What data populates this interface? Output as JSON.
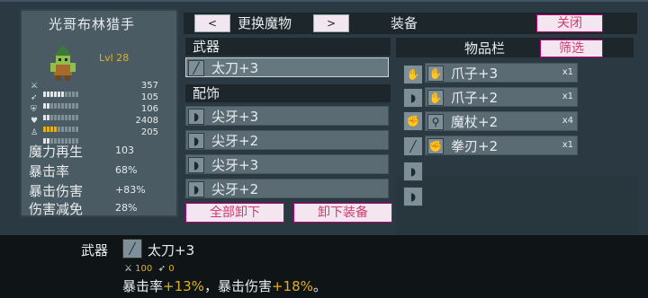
{
  "character": {
    "name": "光哥布林猎手",
    "level": "Lvl 28",
    "stats": [
      {
        "icon": "sword-icon",
        "glyph": "⚔",
        "value": "357"
      },
      {
        "icon": "bow-icon",
        "glyph": "➶",
        "value": "105"
      },
      {
        "icon": "shield-icon",
        "glyph": "⛨",
        "value": "106"
      },
      {
        "icon": "heart-icon",
        "glyph": "♥",
        "value": "2408"
      },
      {
        "icon": "boot-icon",
        "glyph": "♙",
        "value": "205"
      }
    ],
    "attributes": [
      {
        "name": "魔力再生",
        "value": "103"
      },
      {
        "name": "暴击率",
        "value": "68%"
      },
      {
        "name": "暴击伤害",
        "value": "+83%"
      },
      {
        "name": "伤害减免",
        "value": "28%"
      }
    ]
  },
  "topbar": {
    "prev": "<",
    "title": "更换魔物",
    "next": ">",
    "equip_title": "装备",
    "close": "关闭"
  },
  "weapon_section": {
    "title": "武器",
    "item": "太刀+3"
  },
  "accessory_section": {
    "title": "配饰",
    "items": [
      "尖牙+3",
      "尖牙+2",
      "尖牙+3",
      "尖牙+2"
    ]
  },
  "actions": {
    "unequip_all": "全部卸下",
    "unequip": "卸下装备"
  },
  "inventory": {
    "title": "物品栏",
    "filter": "筛选",
    "items": [
      {
        "name": "爪子+3",
        "count": "x1"
      },
      {
        "name": "爪子+2",
        "count": "x1"
      },
      {
        "name": "魔杖+2",
        "count": "x4"
      },
      {
        "name": "拳刃+2",
        "count": "x1"
      }
    ]
  },
  "info": {
    "type": "武器",
    "name": "太刀+3",
    "stat_attack": "100",
    "stat_other": "0",
    "desc_crit_label": "暴击率",
    "desc_crit_value": "+13%",
    "desc_sep": "，",
    "desc_critdmg_label": "暴击伤害",
    "desc_critdmg_value": "+18%",
    "desc_end": "。"
  },
  "colors": {
    "accent": "#d23a6a",
    "gold": "#e0b020"
  }
}
